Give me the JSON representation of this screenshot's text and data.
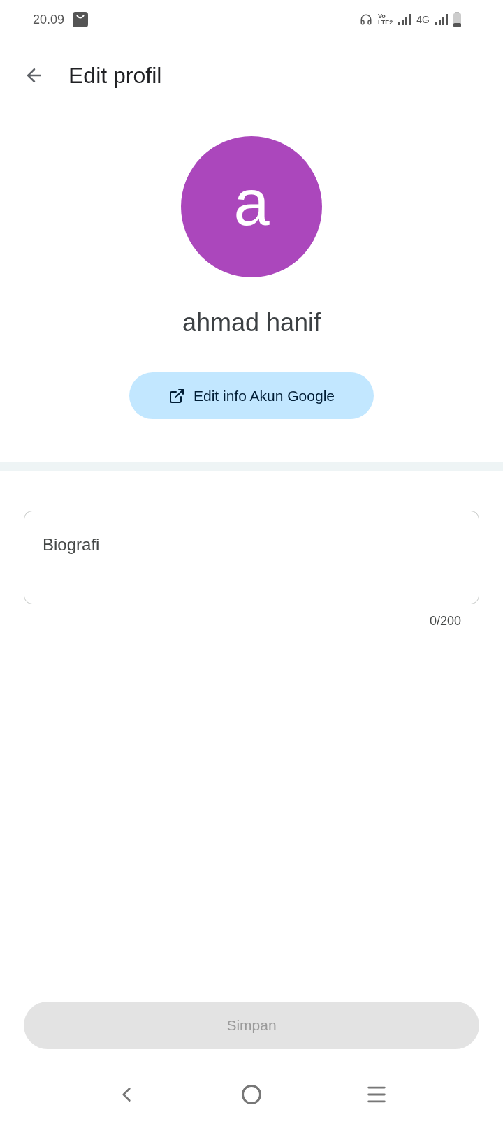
{
  "status_bar": {
    "time": "20.09",
    "volte_top": "Vo",
    "volte_bottom": "LTE2",
    "network": "4G"
  },
  "header": {
    "title": "Edit profil"
  },
  "profile": {
    "avatar_letter": "a",
    "name": "ahmad hanif",
    "edit_button": "Edit info Akun Google"
  },
  "bio_field": {
    "placeholder": "Biografi",
    "counter": "0/200"
  },
  "save_button": {
    "label": "Simpan",
    "disabled": true
  }
}
